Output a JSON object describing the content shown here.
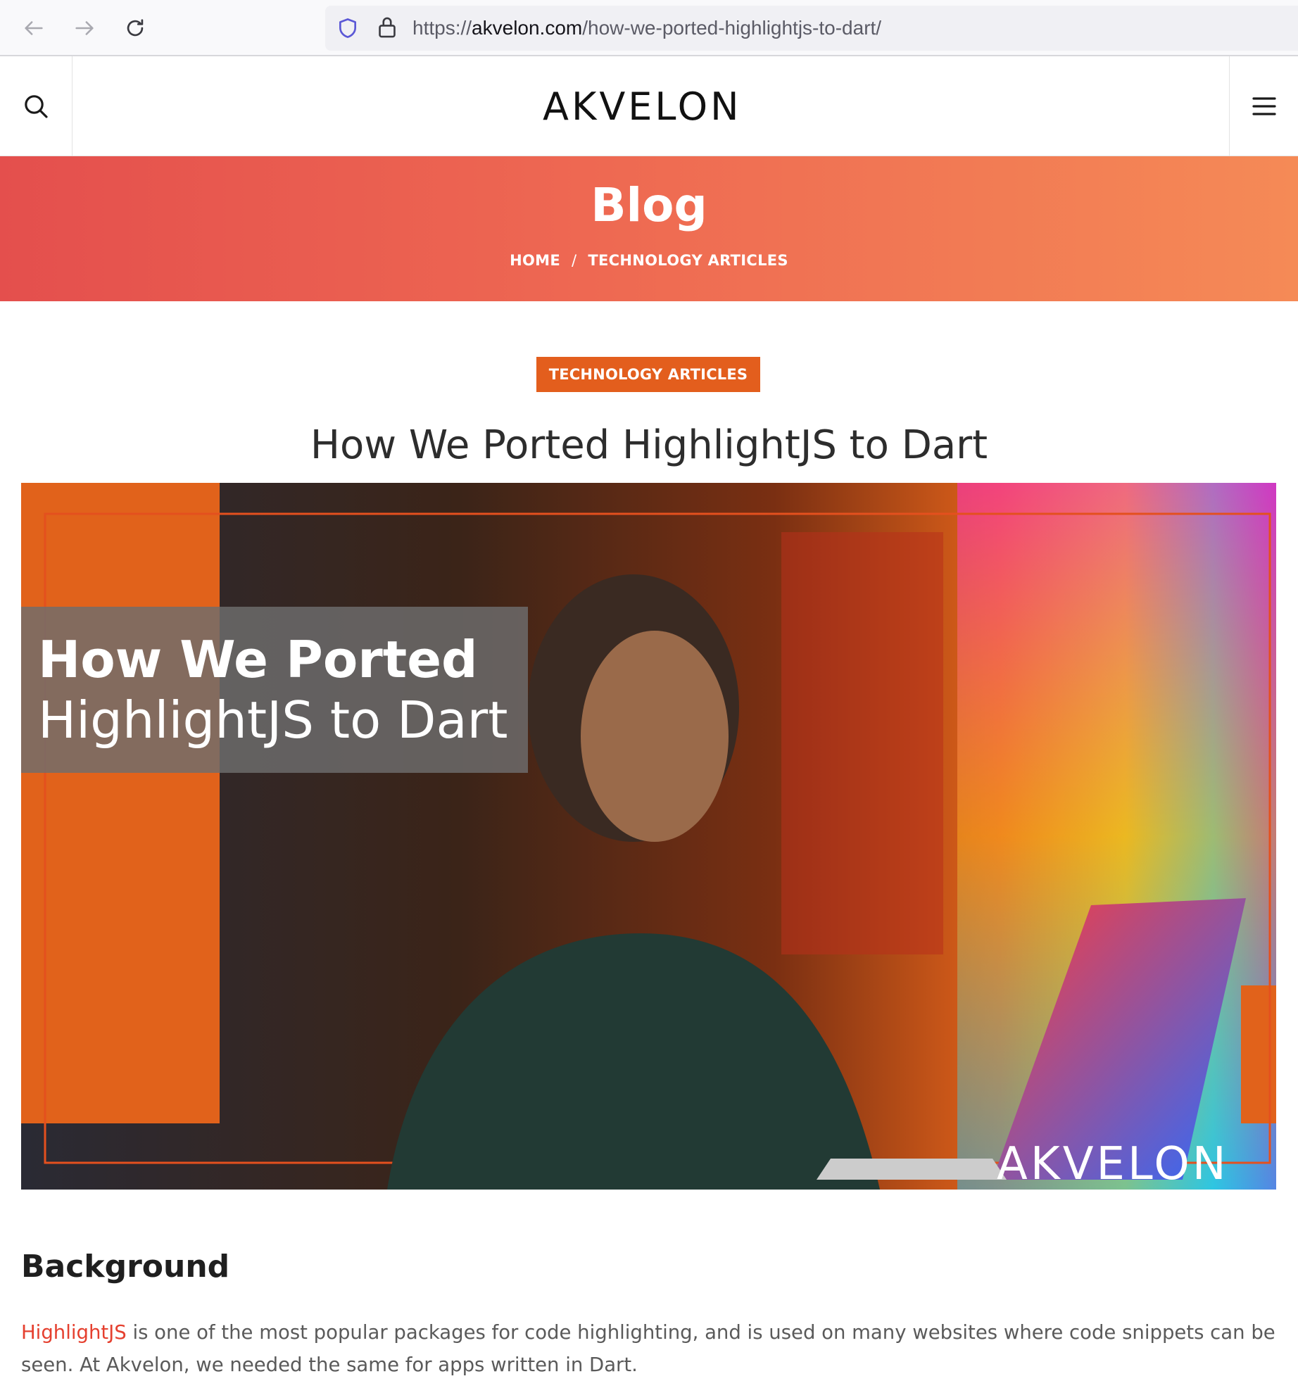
{
  "browser": {
    "url_prefix": "https://",
    "url_domain": "akvelon.com",
    "url_path": "/how-we-ported-highlightjs-to-dart/"
  },
  "header": {
    "logo_text": "AKVELON",
    "icons": {
      "search": "search-icon",
      "menu": "hamburger-menu-icon"
    }
  },
  "hero": {
    "title": "Blog",
    "breadcrumb": {
      "home": "HOME",
      "separator": "/",
      "current": "TECHNOLOGY ARTICLES"
    }
  },
  "article": {
    "category": "TECHNOLOGY ARTICLES",
    "title": "How We Ported HighlightJS to Dart",
    "image": {
      "caption_line1": "How We Ported",
      "caption_line2": "HighlightJS to Dart",
      "logo_text": "AKVELON"
    },
    "section_heading": "Background",
    "paragraph_link": "HighlightJS",
    "paragraph_rest": " is one of the most popular packages for code highlighting, and is used on many websites where code snippets can be seen.  At Akvelon, we needed the same for apps written in Dart."
  },
  "colors": {
    "accent": "#e35e1d",
    "hero_start": "#e44f4d",
    "hero_end": "#f58a56",
    "link": "#e5402f"
  }
}
